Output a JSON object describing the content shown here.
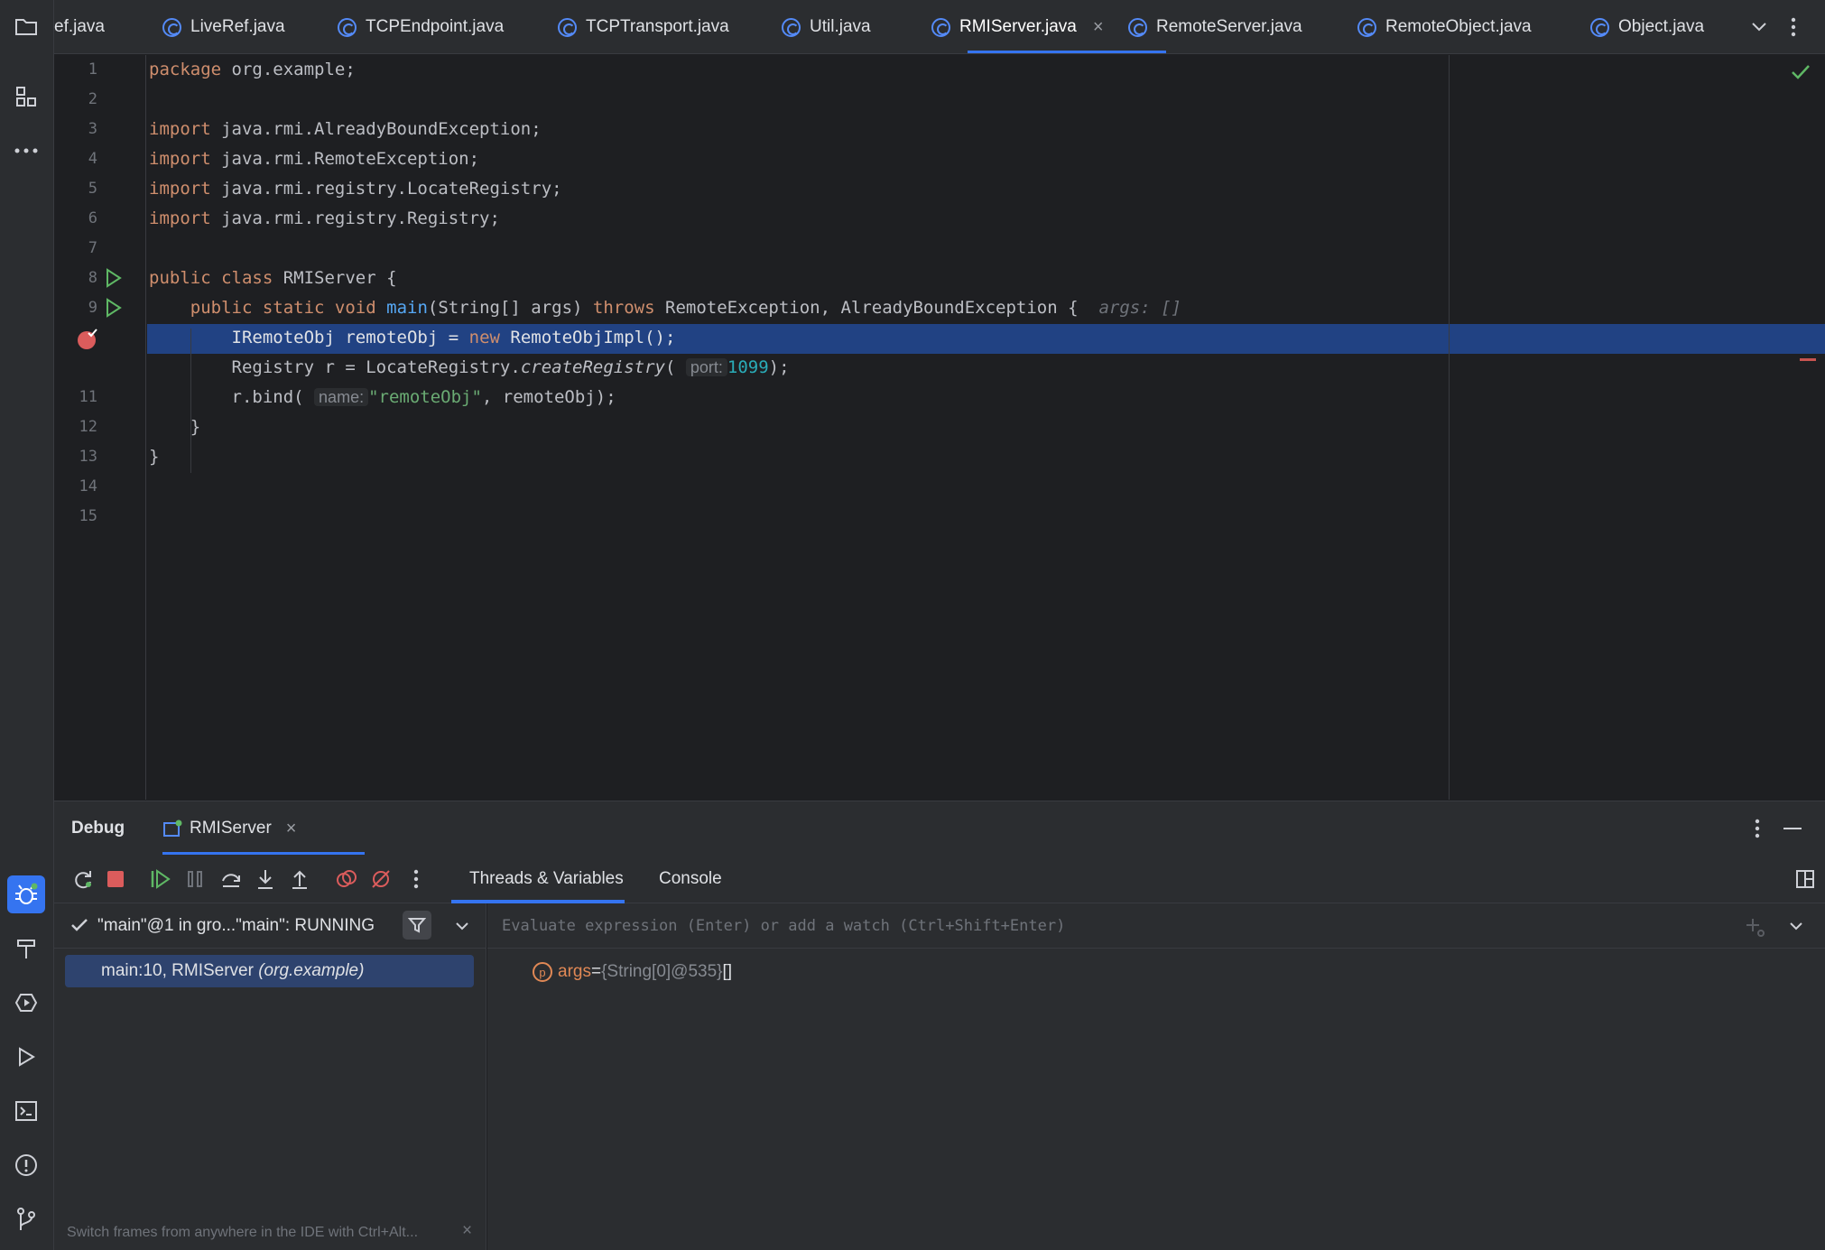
{
  "tabs": [
    {
      "label": "ef.java"
    },
    {
      "label": "LiveRef.java"
    },
    {
      "label": "TCPEndpoint.java"
    },
    {
      "label": "TCPTransport.java"
    },
    {
      "label": "Util.java"
    },
    {
      "label": "RMIServer.java",
      "active": true
    },
    {
      "label": "RemoteServer.java"
    },
    {
      "label": "RemoteObject.java"
    },
    {
      "label": "Object.java"
    }
  ],
  "editor": {
    "line_numbers": [
      "1",
      "2",
      "3",
      "4",
      "5",
      "6",
      "7",
      "8",
      "9",
      "",
      "11",
      "12",
      "13",
      "14",
      "15"
    ],
    "line1": {
      "kw": "package",
      "rest": " org.example;"
    },
    "line3": {
      "kw": "import",
      "rest": " java.rmi.AlreadyBoundException;"
    },
    "line4": {
      "kw": "import",
      "rest": " java.rmi.RemoteException;"
    },
    "line5": {
      "kw": "import",
      "rest": " java.rmi.registry.LocateRegistry;"
    },
    "line6": {
      "kw": "import",
      "rest": " java.rmi.registry.Registry;"
    },
    "line8": {
      "kw": "public class",
      "rest": " RMIServer {"
    },
    "line9": {
      "kw1": "public static void",
      "fn": "main",
      "mid": "(String[] args) ",
      "kw2": "throws",
      "rest": " RemoteException, AlreadyBoundException {",
      "ghost": "args: []"
    },
    "line10": {
      "pre": "IRemoteObj remoteObj = ",
      "kw": "new",
      "rest": " RemoteObjImpl();"
    },
    "line11": {
      "pre": "Registry r = LocateRegistry.",
      "fn": "createRegistry",
      "open": "(",
      "hint": "port:",
      "num": "1099",
      "close": ");"
    },
    "line12": {
      "pre": "r.bind(",
      "hint": "name:",
      "str": "\"remoteObj\"",
      "rest": ", remoteObj);"
    },
    "line13": "}",
    "line14": "}"
  },
  "debug": {
    "title": "Debug",
    "session_tab": "RMIServer",
    "subtabs": [
      "Threads & Variables",
      "Console"
    ],
    "thread_label": "\"main\"@1 in gro...\"main\": RUNNING",
    "frame": {
      "method": "main:10, RMIServer",
      "package": "(org.example)"
    },
    "eval_placeholder": "Evaluate expression (Enter) or add a watch (Ctrl+Shift+Enter)",
    "variable": {
      "name": "args",
      "eq": " = ",
      "ref": "{String[0]@535}",
      "value": " []"
    },
    "hint_bar": "Switch frames from anywhere in the IDE with Ctrl+Alt..."
  },
  "colors": {
    "accent": "#3574f0",
    "selection": "#214283",
    "keyword": "#cf8e6d",
    "function": "#56a8f5",
    "string": "#6aab73",
    "number": "#2aacb8"
  }
}
